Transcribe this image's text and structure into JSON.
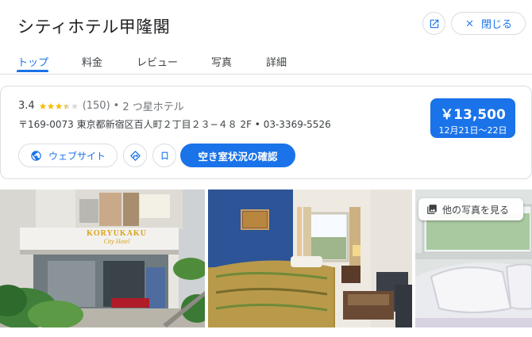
{
  "header": {
    "title": "シティホテル甲隆閣",
    "close_label": "閉じる"
  },
  "tabs": [
    {
      "label": "トップ",
      "active": true
    },
    {
      "label": "料金",
      "active": false
    },
    {
      "label": "レビュー",
      "active": false
    },
    {
      "label": "写真",
      "active": false
    },
    {
      "label": "詳細",
      "active": false
    }
  ],
  "info": {
    "rating": "3.4",
    "stars_value": 3.4,
    "review_count": "(150)",
    "separator": "•",
    "category": "2 つ星ホテル",
    "address": "〒169-0073 東京都新宿区百人町２丁目２３−４８ 2F • 03-3369-5526"
  },
  "price": {
    "amount": "￥13,500",
    "dates": "12月21日～22日"
  },
  "actions": {
    "website_label": "ウェブサイト",
    "check_label": "空き室状況の確認"
  },
  "photos": {
    "more_label": "他の写真を見る",
    "sign_line1": "KORYUKAKU",
    "sign_line2": "City Hotel"
  },
  "colors": {
    "accent": "#1a73e8",
    "star": "#fbbc04",
    "star_empty": "#dadce0"
  }
}
